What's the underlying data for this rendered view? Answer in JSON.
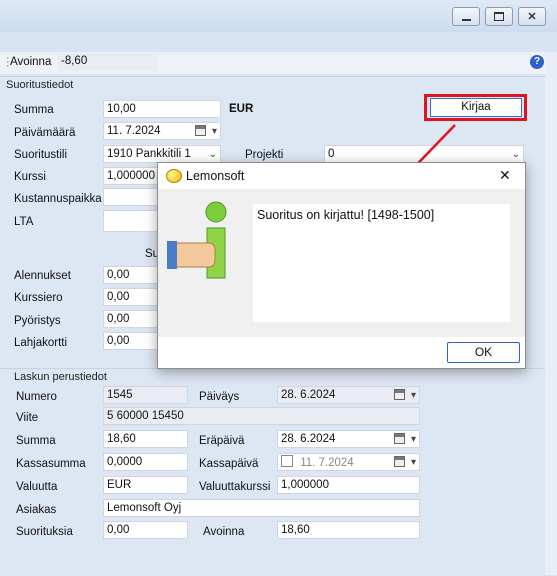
{
  "window": {
    "minimize_icon": "minimize-icon",
    "maximize_icon": "maximize-icon",
    "close_icon": "close-icon"
  },
  "toolbar": {
    "label": "Avoinna",
    "value": "-8,60"
  },
  "payment": {
    "section_title": "Suoritustiedot",
    "summa_label": "Summa",
    "summa_value": "10,00",
    "currency": "EUR",
    "paivamaara_label": "Päivämäärä",
    "paivamaara_value": "11. 7.2024",
    "suoritustili_label": "Suoritustili",
    "suoritustili_value": "1910 Pankkitili 1",
    "projekti_label": "Projekti",
    "projekti_value": "0",
    "kurssi_label": "Kurssi",
    "kurssi_value": "1,000000",
    "kustannuspaikka_label": "Kustannuspaikka",
    "lta_label": "LTA",
    "partial_label": "Su",
    "alennukset_label": "Alennukset",
    "alennukset_value": "0,00",
    "kurssiero_label": "Kurssiero",
    "kurssiero_value": "0,00",
    "pyoristys_label": "Pyöristys",
    "pyoristys_value": "0,00",
    "lahjakortti_label": "Lahjakortti",
    "lahjakortti_value": "0,00",
    "kirjaa_label": "Kirjaa"
  },
  "invoice": {
    "section_title": "Laskun perustiedot",
    "numero_label": "Numero",
    "numero_value": "1545",
    "paivays_label": "Päiväys",
    "paivays_value": "28. 6.2024",
    "viite_label": "Viite",
    "viite_value": "5 60000 15450",
    "summa_label": "Summa",
    "summa_value": "18,60",
    "erapaiva_label": "Eräpäivä",
    "erapaiva_value": "28. 6.2024",
    "kassasumma_label": "Kassasumma",
    "kassasumma_value": "0,0000",
    "kassapaiva_label": "Kassapäivä",
    "kassapaiva_value": "11. 7.2024",
    "valuutta_label": "Valuutta",
    "valuutta_value": "EUR",
    "valuuttakurssi_label": "Valuuttakurssi",
    "valuuttakurssi_value": "1,000000",
    "asiakas_label": "Asiakas",
    "asiakas_value": "Lemonsoft Oyj",
    "suorituksia_label": "Suorituksia",
    "suorituksia_value": "0,00",
    "avoinna_label": "Avoinna",
    "avoinna_value": "18,60"
  },
  "dialog": {
    "title": "Lemonsoft",
    "message": "Suoritus on kirjattu! [1498-1500]",
    "ok_label": "OK",
    "close_label": "✕"
  },
  "colors": {
    "highlight": "#e0141e",
    "accent": "#2e63c9"
  }
}
